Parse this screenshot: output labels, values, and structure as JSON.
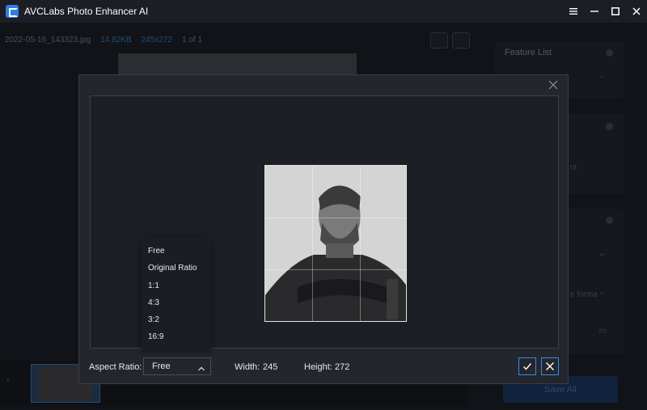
{
  "app": {
    "title": "AVCLabs Photo Enhancer AI"
  },
  "background": {
    "file_name": "2022-05-16_143323.jpg",
    "file_size": "14.82KB",
    "dimensions": "245x272",
    "page_count": "1 of 1",
    "panel_title": "Feature List",
    "bg_text_1": "nt",
    "bg_text_2": "e forma",
    "save_all_label": "Save All"
  },
  "dialog": {
    "aspect_ratio_label": "Aspect Ratio:",
    "aspect_ratio_value": "Free",
    "width_label": "Width:",
    "width_value": "245",
    "height_label": "Height:",
    "height_value": "272",
    "ratio_options": [
      "Free",
      "Original Ratio",
      "1:1",
      "4:3",
      "3:2",
      "16:9"
    ]
  },
  "colors": {
    "accent": "#3a8ae8",
    "dialog_bg": "#23262d",
    "titlebar_bg": "#1b1e24"
  }
}
